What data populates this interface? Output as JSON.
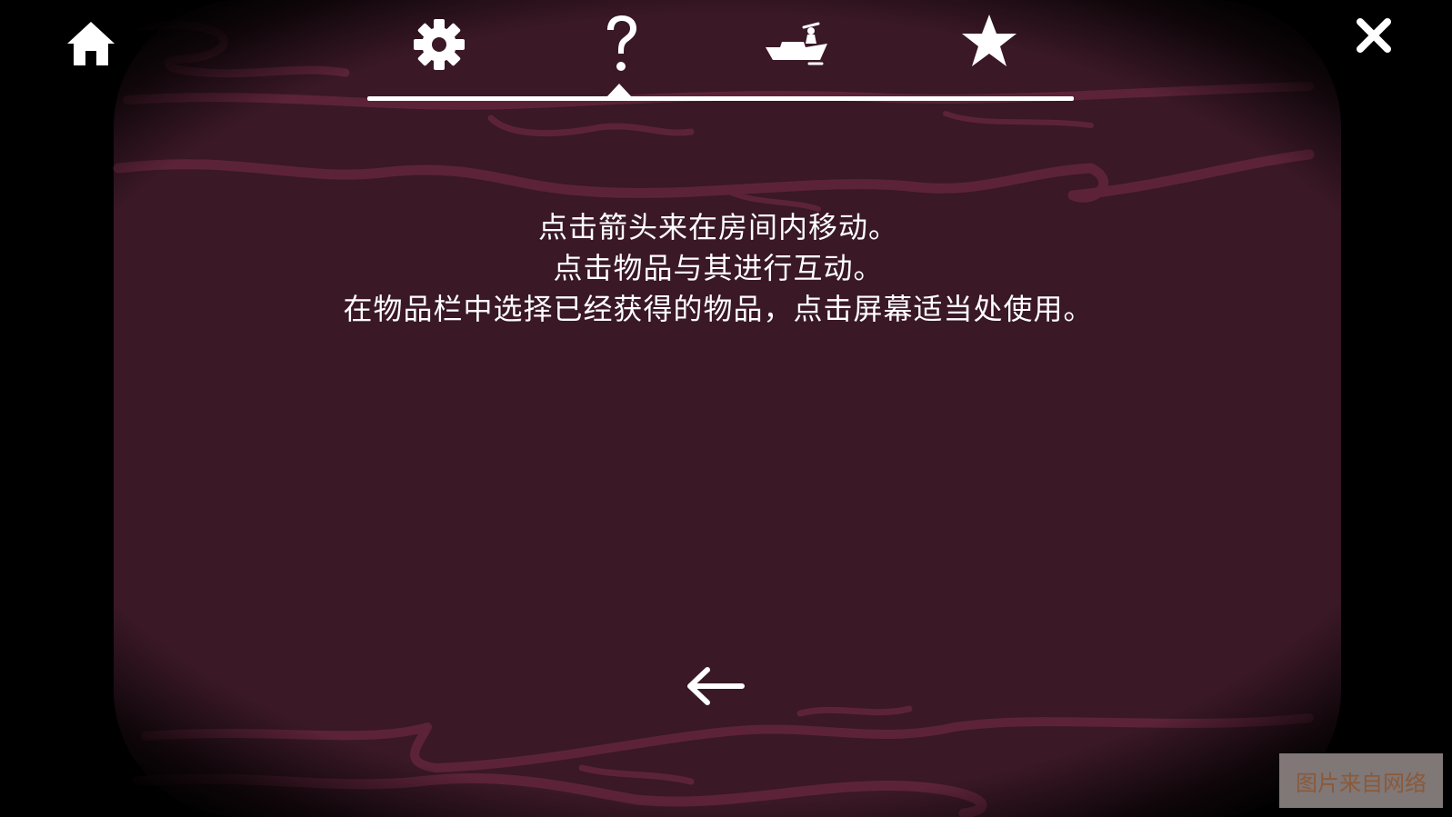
{
  "colors": {
    "panel_background": "#3a1826",
    "river_stroke": "#5c2338",
    "vignette": "#000000",
    "icon": "#ffffff"
  },
  "toolbar": {
    "home_icon": "home-icon",
    "close_icon": "close-icon",
    "tabs": [
      {
        "icon": "gear-icon",
        "name": "settings",
        "selected": false
      },
      {
        "icon": "question-icon",
        "name": "help",
        "selected": true
      },
      {
        "icon": "boat-icon",
        "name": "boat",
        "selected": false
      },
      {
        "icon": "star-icon",
        "name": "favorites",
        "selected": false
      }
    ]
  },
  "help": {
    "lines": [
      "点击箭头来在房间内移动。",
      "点击物品与其进行互动。",
      "在物品栏中选择已经获得的物品，点击屏幕适当处使用。"
    ]
  },
  "navigation": {
    "back_icon": "arrow-left-icon"
  },
  "watermark": {
    "text": "图片来自网络"
  }
}
